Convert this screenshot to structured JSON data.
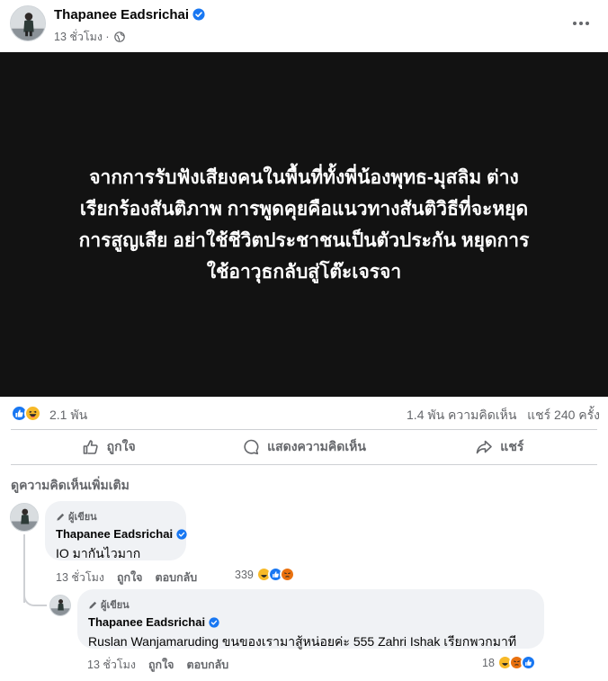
{
  "post": {
    "author": "Thapanee Eadsrichai",
    "time": "13 ชั่วโมง",
    "meta_separator": "·",
    "image_text": "จากการรับฟังเสียงคนในพื้นที่ทั้งพี่น้องพุทธ-มุสลิม ต่าง\nเรียกร้องสันติภาพ การพูดคุยคือแนวทางสันติวิธีที่จะหยุด\nการสูญเสีย อย่าใช้ชีวิตประชาชนเป็นตัวประกัน หยุดการ\nใช้อาวุธกลับสู่โต๊ะเจรจา"
  },
  "stats": {
    "reactions_count": "2.1 พัน",
    "comments": "1.4 พัน ความคิดเห็น",
    "shares": "แชร์ 240 ครั้ง"
  },
  "actions": {
    "like": "ถูกใจ",
    "comment": "แสดงความคิดเห็น",
    "share": "แชร์"
  },
  "more_comments": "ดูความคิดเห็นเพิ่มเติม",
  "comments": [
    {
      "badge": "ผู้เขียน",
      "name": "Thapanee Eadsrichai",
      "text": "IO มากันไวมาก",
      "time": "13 ชั่วโมง",
      "like": "ถูกใจ",
      "reply": "ตอบกลับ",
      "reactions": "339"
    },
    {
      "badge": "ผู้เขียน",
      "name": "Thapanee Eadsrichai",
      "text": "Ruslan Wanjamaruding ขนของเรามาสู้หน่อยค่ะ 555 Zahri Ishak เรียกพวกมาที",
      "time": "13 ชั่วโมง",
      "like": "ถูกใจ",
      "reply": "ตอบกลับ",
      "reactions": "18"
    }
  ],
  "colors": {
    "accent": "#1877f2",
    "muted": "#65676b",
    "image_bg": "#121212",
    "bubble": "#f0f2f5"
  },
  "icons": [
    "more-icon",
    "verified-icon",
    "globe-icon",
    "like-reaction-icon",
    "haha-reaction-icon",
    "angry-reaction-icon",
    "thumbs-up-icon",
    "comment-icon",
    "share-icon",
    "pencil-icon"
  ]
}
